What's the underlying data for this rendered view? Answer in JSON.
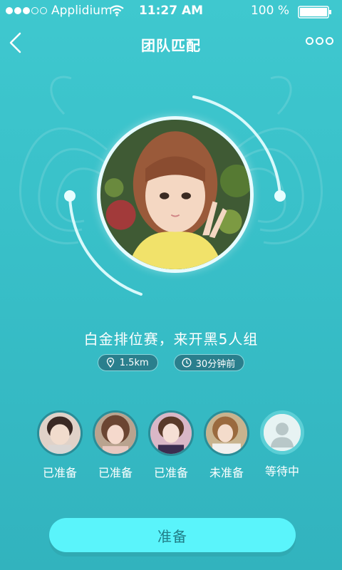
{
  "status": {
    "carrier": "Applidium",
    "time": "11:27 AM",
    "battery_pct": "100 %"
  },
  "nav": {
    "title": "团队匹配"
  },
  "match": {
    "title": "白金排位赛，来开黑5人组",
    "distance": "1.5km",
    "time_ago": "30分钟前"
  },
  "members": [
    {
      "label": "已准备"
    },
    {
      "label": "已准备"
    },
    {
      "label": "已准备"
    },
    {
      "label": "未准备"
    },
    {
      "label": "等待中"
    }
  ],
  "actions": {
    "ready_label": "准备"
  },
  "colors": {
    "background": "#3cc2cb",
    "button": "#5af4fb",
    "button_text": "#217e88",
    "tag_bg": "#2a7f8d"
  }
}
